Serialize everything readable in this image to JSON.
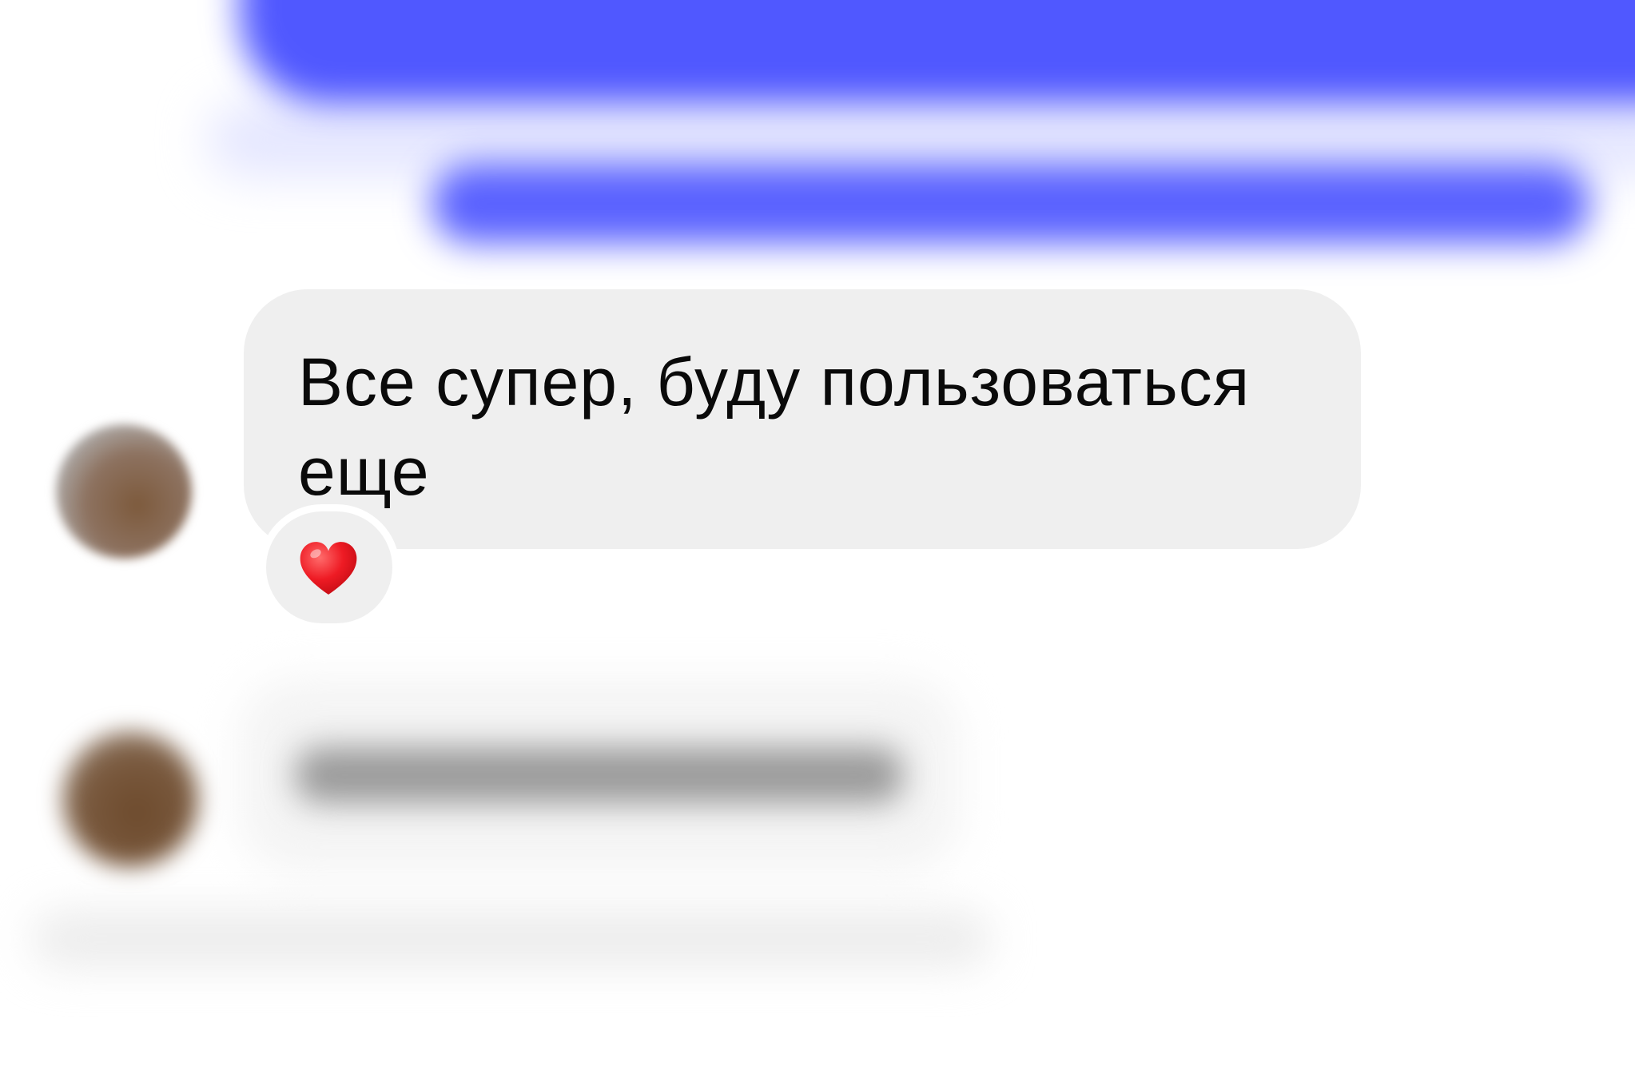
{
  "chat": {
    "incoming_message": {
      "text": "Все супер, буду пользоваться еще",
      "reaction": "heart-reaction",
      "bubble_color": "#efefef"
    }
  },
  "colors": {
    "outgoing_bubble": "#5058ff",
    "background": "#ffffff"
  }
}
